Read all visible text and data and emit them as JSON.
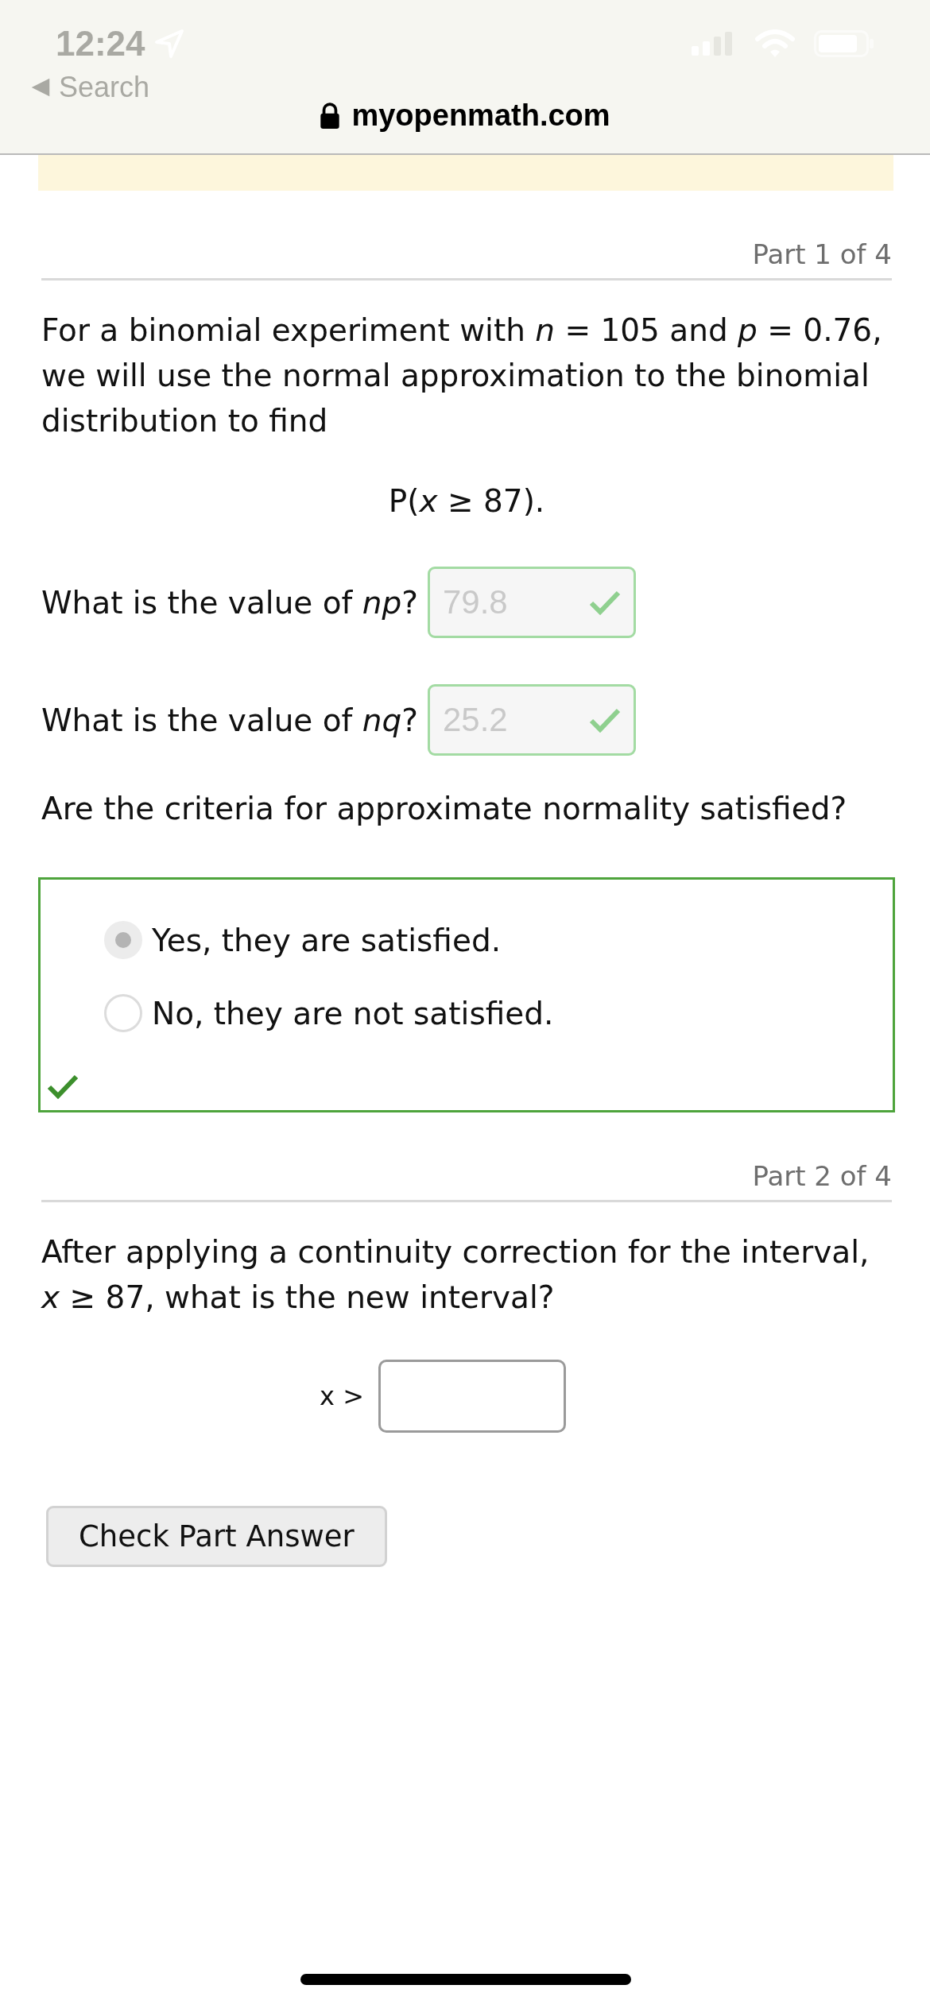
{
  "status_bar": {
    "time": "12:24",
    "back_link": "Search"
  },
  "address_bar": {
    "url": "myopenmath.com",
    "secure": true
  },
  "parts": [
    {
      "label": "Part 1 of 4",
      "intro": "For a binomial experiment with *n* = 105 and *p* = 0.76, we will use the normal approximation to the binomial distribution to find",
      "formula": "P(*x* ≥ 87).",
      "questions": [
        {
          "kind": "input",
          "prompt": "What is the value of *np*?",
          "value": "79.8",
          "correct": true
        },
        {
          "kind": "input",
          "prompt": "What is the value of *nq*?",
          "value": "25.2",
          "correct": true
        },
        {
          "kind": "choice",
          "prompt": "Are the criteria for approximate normality satisfied?",
          "correct": true,
          "options": [
            {
              "label": "Yes, they are satisfied.",
              "selected": true
            },
            {
              "label": "No, they are not satisfied.",
              "selected": false
            }
          ]
        }
      ]
    },
    {
      "label": "Part 2 of 4",
      "intro": "After applying a continuity correction for the interval, *x* ≥ 87, what is the new interval?",
      "answer_prefix": "x >",
      "button": "Check Part Answer"
    }
  ]
}
